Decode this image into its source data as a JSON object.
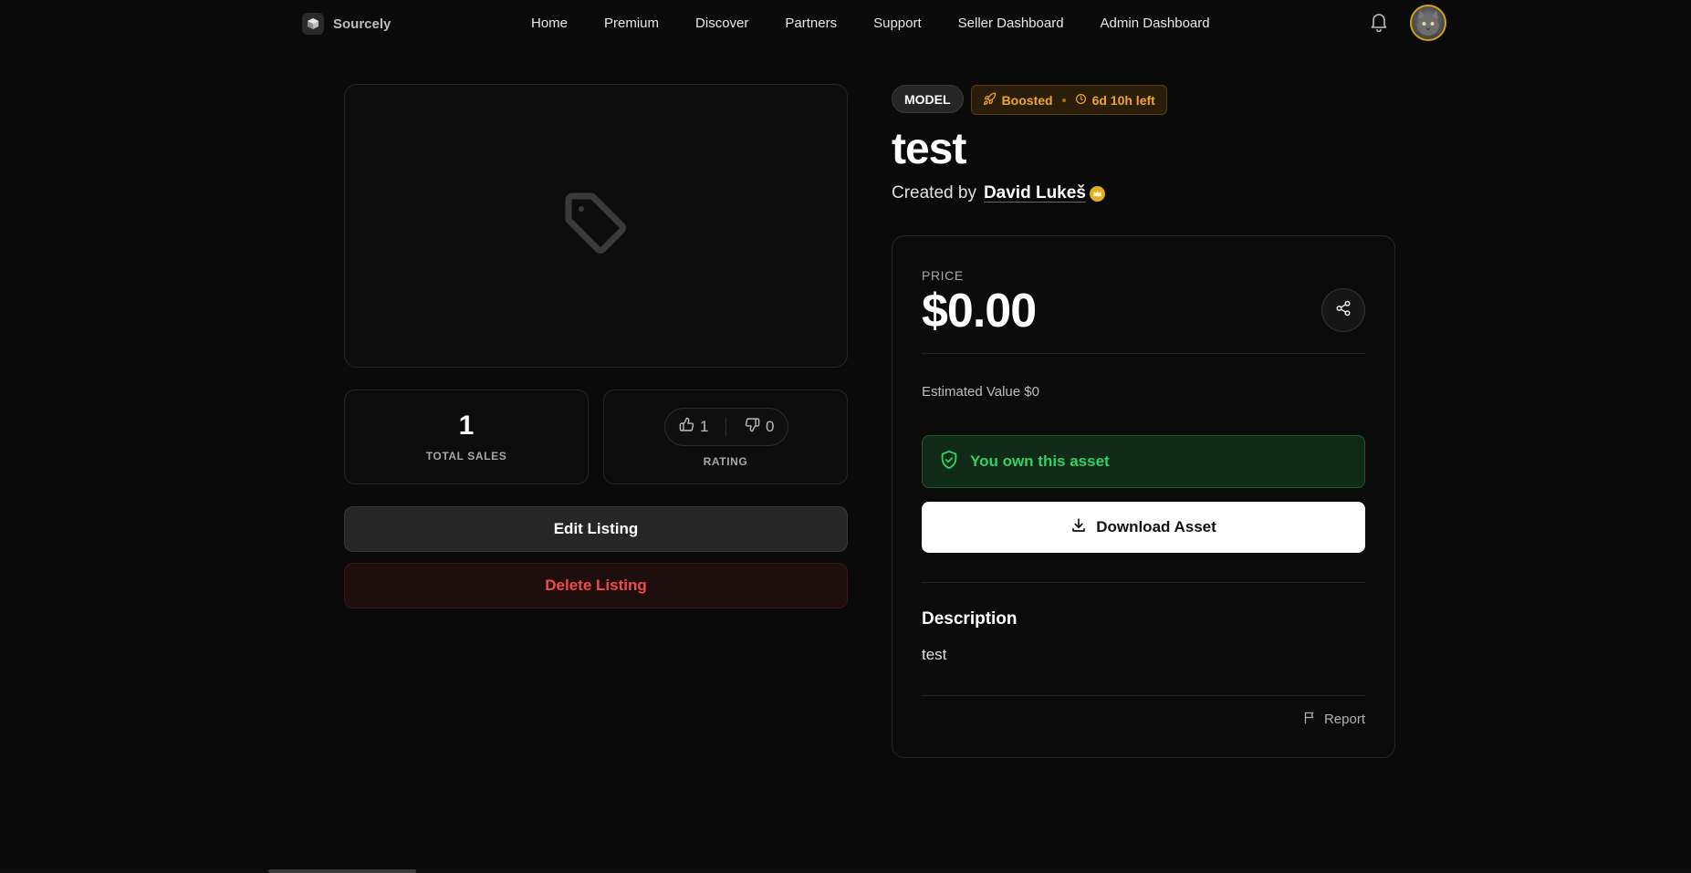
{
  "app": {
    "brand_name": "Sourcely"
  },
  "nav": {
    "items": [
      {
        "label": "Home"
      },
      {
        "label": "Premium"
      },
      {
        "label": "Discover"
      },
      {
        "label": "Partners"
      },
      {
        "label": "Support"
      },
      {
        "label": "Seller Dashboard"
      },
      {
        "label": "Admin Dashboard"
      }
    ],
    "notification_icon": "bell-icon"
  },
  "listing": {
    "category_badge": "MODEL",
    "boost": {
      "label": "Boosted",
      "time_left": "6d 10h left"
    },
    "title": "test",
    "created_by_prefix": "Created by",
    "author": "David Lukeš",
    "thumbnail_icon": "tag-icon"
  },
  "stats": {
    "total_sales": "1",
    "total_sales_label": "TOTAL SALES",
    "likes": "1",
    "dislikes": "0",
    "rating_label": "RATING"
  },
  "actions": {
    "edit_label": "Edit Listing",
    "delete_label": "Delete Listing"
  },
  "price_panel": {
    "price_label": "PRICE",
    "price": "$0.00",
    "estimated_value": "Estimated Value $0",
    "owned_message": "You own this asset",
    "download_label": "Download Asset",
    "description_title": "Description",
    "description_text": "test",
    "report_label": "Report"
  },
  "colors": {
    "background": "#0a0a0a",
    "owned_green": "#2fd267",
    "delete_red": "#f04a4a",
    "boost_orange": "#f0a52a",
    "avatar_ring": "#d4a017"
  }
}
